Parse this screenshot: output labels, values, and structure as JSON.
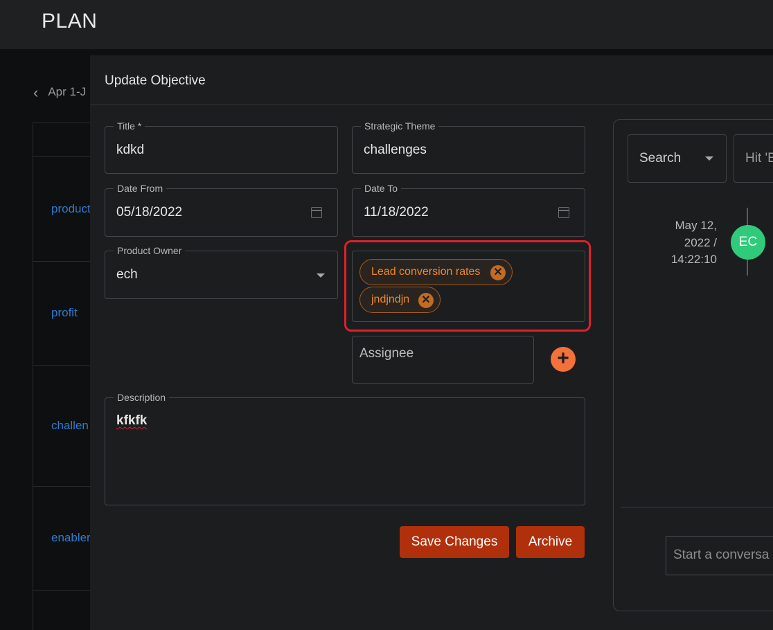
{
  "app": {
    "brand": "PLAN"
  },
  "background": {
    "date_range": "Apr 1-J",
    "rows": [
      "product",
      "profit",
      "challen",
      "enabler"
    ]
  },
  "modal": {
    "title": "Update Objective",
    "fields": {
      "title": {
        "label": "Title *",
        "value": "kdkd"
      },
      "strategic_theme": {
        "label": "Strategic Theme",
        "value": "challenges"
      },
      "date_from": {
        "label": "Date From",
        "value": "05/18/2022"
      },
      "date_to": {
        "label": "Date To",
        "value": "11/18/2022"
      },
      "product_owner": {
        "label": "Product Owner",
        "value": "ech"
      },
      "tags": [
        {
          "label": "Lead conversion rates",
          "remove": "✕"
        },
        {
          "label": "jndjndjn",
          "remove": "✕"
        }
      ],
      "assignee": {
        "placeholder": "Assignee",
        "add_icon": "+"
      },
      "description": {
        "label": "Description",
        "value": "kfkfk"
      }
    },
    "buttons": {
      "save": "Save Changes",
      "archive": "Archive"
    }
  },
  "side_panel": {
    "search_select": "Search",
    "search_placeholder": "Hit 'E",
    "timeline": {
      "date_line1": "May 12,",
      "date_line2": "2022 /",
      "time": "14:22:10",
      "avatar_initials": "EC"
    },
    "conversation_placeholder": "Start a conversa"
  },
  "colors": {
    "accent_button": "#b1300c",
    "chip_text": "#ef8a2c",
    "highlight_box": "#e0202a",
    "avatar": "#2fcb7a",
    "link": "#2e7bcf"
  }
}
